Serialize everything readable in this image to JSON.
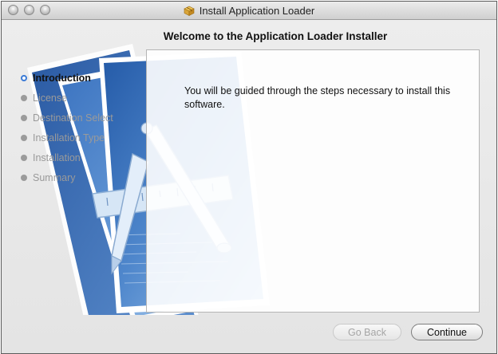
{
  "window": {
    "title": "Install Application Loader",
    "title_icon": "package-icon"
  },
  "main": {
    "heading": "Welcome to the Application Loader Installer",
    "body_text": "You will be guided through the steps necessary to install this software."
  },
  "steps": [
    {
      "label": "Introduction",
      "state": "current"
    },
    {
      "label": "License",
      "state": "pending"
    },
    {
      "label": "Destination Select",
      "state": "pending"
    },
    {
      "label": "Installation Type",
      "state": "pending"
    },
    {
      "label": "Installation",
      "state": "pending"
    },
    {
      "label": "Summary",
      "state": "pending"
    }
  ],
  "buttons": {
    "back_label": "Go Back",
    "back_enabled": false,
    "continue_label": "Continue"
  },
  "colors": {
    "accent": "#3d7cd6",
    "art_blue": "#2f64ad"
  }
}
